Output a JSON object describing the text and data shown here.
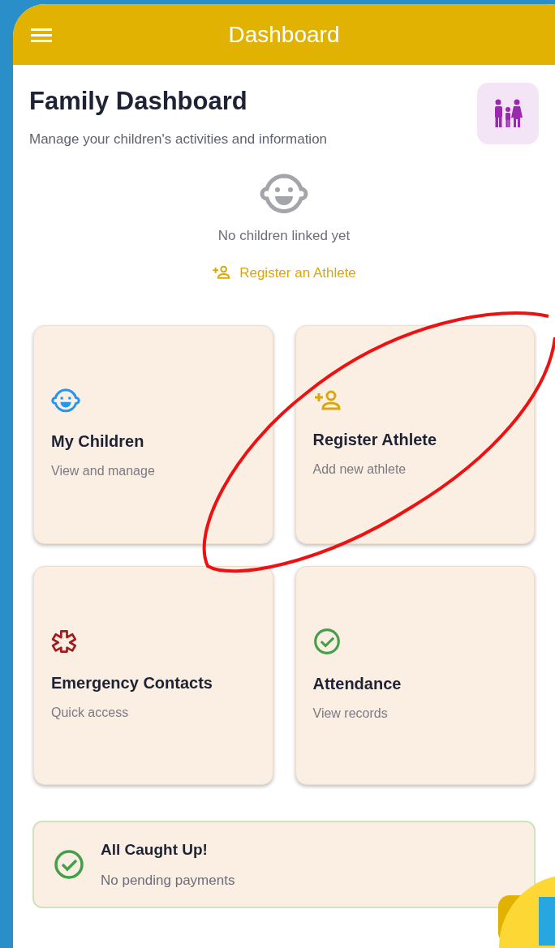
{
  "app_bar": {
    "title": "Dashboard"
  },
  "intro": {
    "title": "Family Dashboard",
    "subtitle": "Manage your children's activities and information"
  },
  "empty_state": {
    "message": "No children linked yet",
    "action": "Register an Athlete"
  },
  "cards": [
    {
      "kind": "children",
      "title": "My Children",
      "subtitle": "View and manage"
    },
    {
      "kind": "register",
      "title": "Register Athlete",
      "subtitle": "Add new athlete"
    },
    {
      "kind": "emergency",
      "title": "Emergency Contacts",
      "subtitle": "Quick access"
    },
    {
      "kind": "attendance",
      "title": "Attendance",
      "subtitle": "View records"
    }
  ],
  "payments": {
    "title": "All Caught Up!",
    "subtitle": "No pending payments"
  }
}
